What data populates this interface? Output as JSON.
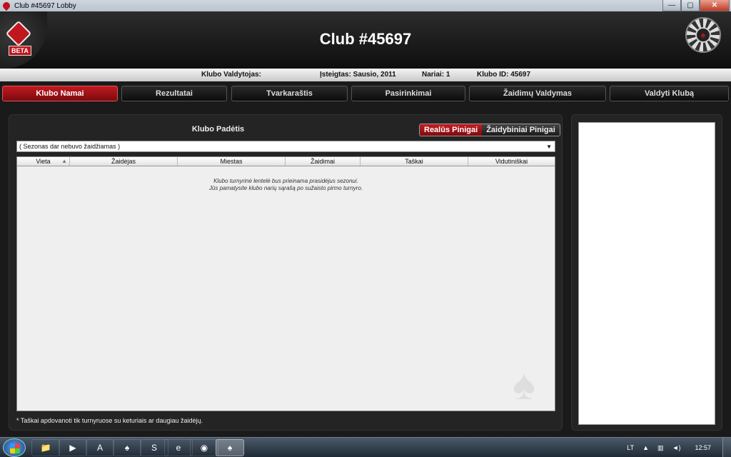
{
  "window": {
    "title": "Club #45697 Lobby",
    "min_symbol": "—",
    "max_symbol": "▢",
    "close_symbol": "✕"
  },
  "header": {
    "title": "Club #45697",
    "logo_badge": "BETA",
    "chip_symbol": "♠"
  },
  "info": {
    "owner": "Klubo Valdytojas:",
    "founded": "Įsteigtas: Sausio, 2011",
    "members": "Nariai: 1",
    "club_id": "Klubo ID: 45697"
  },
  "nav": {
    "tabs": [
      {
        "label": "Klubo Namai",
        "active": true
      },
      {
        "label": "Rezultatai",
        "active": false
      },
      {
        "label": "Tvarkaraštis",
        "active": false
      },
      {
        "label": "Pasirinkimai",
        "active": false
      },
      {
        "label": "Žaidimų Valdymas",
        "active": false
      },
      {
        "label": "Valdyti Klubą",
        "active": false
      }
    ]
  },
  "standings": {
    "title": "Klubo Padėtis",
    "money_real": "Realūs Pinigai",
    "money_play": "Žaidybiniai Pinigai",
    "season_select": "( Sezonas dar nebuvo žaidžiamas )",
    "columns": [
      "Vieta",
      "Žaidėjas",
      "Miestas",
      "Žaidimai",
      "Taškai",
      "Vidutiniškai"
    ],
    "empty_line1": "Klubo turnyrinė lentelė bus prieinama prasidėjus sezonui.",
    "empty_line2": "Jūs pamatysite klubo narių sąrašą po sužaisto pirmo turnyro.",
    "footnote": "* Taškai apdovanoti tik turnyruose su keturiais ar daugiau žaidėjų."
  },
  "taskbar": {
    "items": [
      "explorer-icon",
      "media-player-icon",
      "acrobat-icon",
      "pokerstars-icon",
      "skype-icon",
      "ie-icon",
      "firefox-icon",
      "pokerstars-lobby-icon"
    ],
    "language": "LT",
    "time": "12:57"
  },
  "colors": {
    "accent_red": "#c11a20",
    "panel_bg": "#242424"
  }
}
